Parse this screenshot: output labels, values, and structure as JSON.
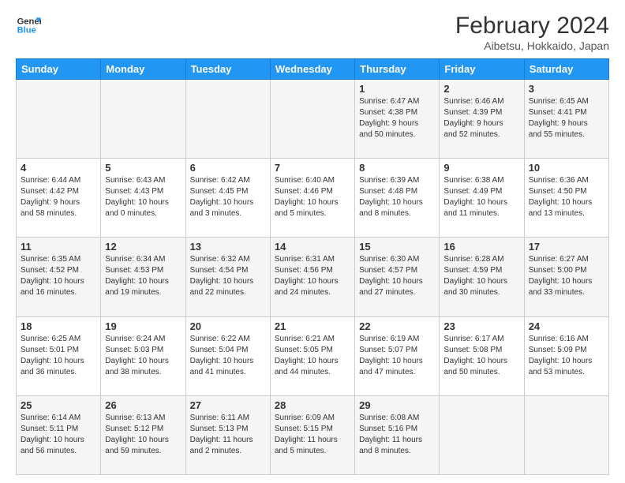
{
  "header": {
    "logo_line1": "General",
    "logo_line2": "Blue",
    "month_year": "February 2024",
    "location": "Aibetsu, Hokkaido, Japan"
  },
  "days_of_week": [
    "Sunday",
    "Monday",
    "Tuesday",
    "Wednesday",
    "Thursday",
    "Friday",
    "Saturday"
  ],
  "weeks": [
    {
      "days": [
        {
          "number": "",
          "info": ""
        },
        {
          "number": "",
          "info": ""
        },
        {
          "number": "",
          "info": ""
        },
        {
          "number": "",
          "info": ""
        },
        {
          "number": "1",
          "info": "Sunrise: 6:47 AM\nSunset: 4:38 PM\nDaylight: 9 hours\nand 50 minutes."
        },
        {
          "number": "2",
          "info": "Sunrise: 6:46 AM\nSunset: 4:39 PM\nDaylight: 9 hours\nand 52 minutes."
        },
        {
          "number": "3",
          "info": "Sunrise: 6:45 AM\nSunset: 4:41 PM\nDaylight: 9 hours\nand 55 minutes."
        }
      ]
    },
    {
      "days": [
        {
          "number": "4",
          "info": "Sunrise: 6:44 AM\nSunset: 4:42 PM\nDaylight: 9 hours\nand 58 minutes."
        },
        {
          "number": "5",
          "info": "Sunrise: 6:43 AM\nSunset: 4:43 PM\nDaylight: 10 hours\nand 0 minutes."
        },
        {
          "number": "6",
          "info": "Sunrise: 6:42 AM\nSunset: 4:45 PM\nDaylight: 10 hours\nand 3 minutes."
        },
        {
          "number": "7",
          "info": "Sunrise: 6:40 AM\nSunset: 4:46 PM\nDaylight: 10 hours\nand 5 minutes."
        },
        {
          "number": "8",
          "info": "Sunrise: 6:39 AM\nSunset: 4:48 PM\nDaylight: 10 hours\nand 8 minutes."
        },
        {
          "number": "9",
          "info": "Sunrise: 6:38 AM\nSunset: 4:49 PM\nDaylight: 10 hours\nand 11 minutes."
        },
        {
          "number": "10",
          "info": "Sunrise: 6:36 AM\nSunset: 4:50 PM\nDaylight: 10 hours\nand 13 minutes."
        }
      ]
    },
    {
      "days": [
        {
          "number": "11",
          "info": "Sunrise: 6:35 AM\nSunset: 4:52 PM\nDaylight: 10 hours\nand 16 minutes."
        },
        {
          "number": "12",
          "info": "Sunrise: 6:34 AM\nSunset: 4:53 PM\nDaylight: 10 hours\nand 19 minutes."
        },
        {
          "number": "13",
          "info": "Sunrise: 6:32 AM\nSunset: 4:54 PM\nDaylight: 10 hours\nand 22 minutes."
        },
        {
          "number": "14",
          "info": "Sunrise: 6:31 AM\nSunset: 4:56 PM\nDaylight: 10 hours\nand 24 minutes."
        },
        {
          "number": "15",
          "info": "Sunrise: 6:30 AM\nSunset: 4:57 PM\nDaylight: 10 hours\nand 27 minutes."
        },
        {
          "number": "16",
          "info": "Sunrise: 6:28 AM\nSunset: 4:59 PM\nDaylight: 10 hours\nand 30 minutes."
        },
        {
          "number": "17",
          "info": "Sunrise: 6:27 AM\nSunset: 5:00 PM\nDaylight: 10 hours\nand 33 minutes."
        }
      ]
    },
    {
      "days": [
        {
          "number": "18",
          "info": "Sunrise: 6:25 AM\nSunset: 5:01 PM\nDaylight: 10 hours\nand 36 minutes."
        },
        {
          "number": "19",
          "info": "Sunrise: 6:24 AM\nSunset: 5:03 PM\nDaylight: 10 hours\nand 38 minutes."
        },
        {
          "number": "20",
          "info": "Sunrise: 6:22 AM\nSunset: 5:04 PM\nDaylight: 10 hours\nand 41 minutes."
        },
        {
          "number": "21",
          "info": "Sunrise: 6:21 AM\nSunset: 5:05 PM\nDaylight: 10 hours\nand 44 minutes."
        },
        {
          "number": "22",
          "info": "Sunrise: 6:19 AM\nSunset: 5:07 PM\nDaylight: 10 hours\nand 47 minutes."
        },
        {
          "number": "23",
          "info": "Sunrise: 6:17 AM\nSunset: 5:08 PM\nDaylight: 10 hours\nand 50 minutes."
        },
        {
          "number": "24",
          "info": "Sunrise: 6:16 AM\nSunset: 5:09 PM\nDaylight: 10 hours\nand 53 minutes."
        }
      ]
    },
    {
      "days": [
        {
          "number": "25",
          "info": "Sunrise: 6:14 AM\nSunset: 5:11 PM\nDaylight: 10 hours\nand 56 minutes."
        },
        {
          "number": "26",
          "info": "Sunrise: 6:13 AM\nSunset: 5:12 PM\nDaylight: 10 hours\nand 59 minutes."
        },
        {
          "number": "27",
          "info": "Sunrise: 6:11 AM\nSunset: 5:13 PM\nDaylight: 11 hours\nand 2 minutes."
        },
        {
          "number": "28",
          "info": "Sunrise: 6:09 AM\nSunset: 5:15 PM\nDaylight: 11 hours\nand 5 minutes."
        },
        {
          "number": "29",
          "info": "Sunrise: 6:08 AM\nSunset: 5:16 PM\nDaylight: 11 hours\nand 8 minutes."
        },
        {
          "number": "",
          "info": ""
        },
        {
          "number": "",
          "info": ""
        }
      ]
    }
  ]
}
